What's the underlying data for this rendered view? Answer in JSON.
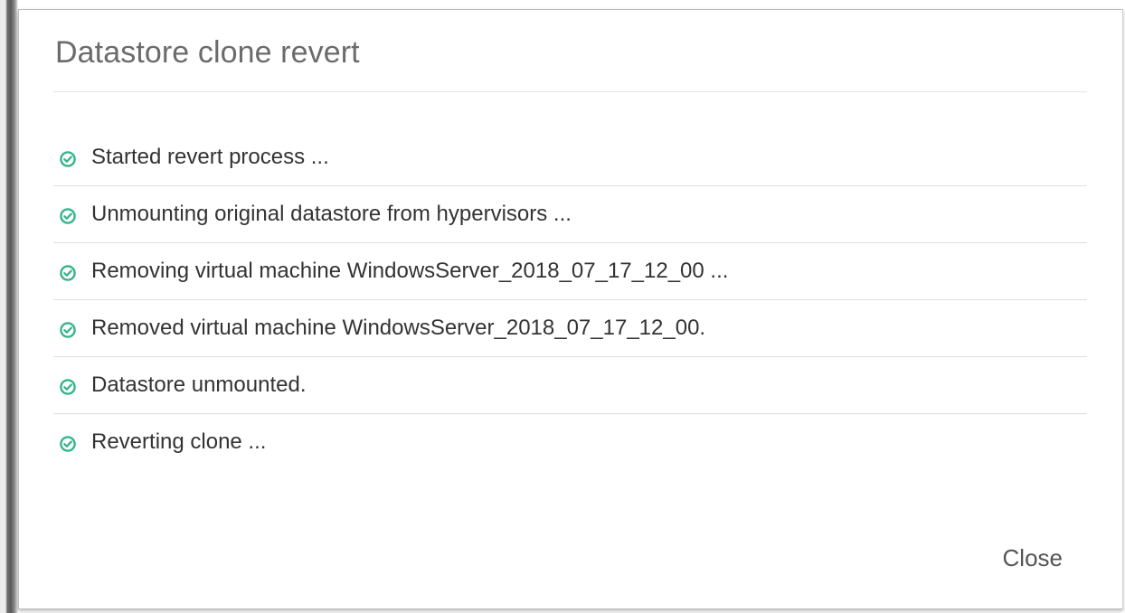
{
  "dialog": {
    "title": "Datastore clone revert",
    "close_label": "Close"
  },
  "log": {
    "items": [
      {
        "text": "Started revert process ...",
        "status": "success"
      },
      {
        "text": "Unmounting original datastore from hypervisors ...",
        "status": "success"
      },
      {
        "text": "Removing virtual machine WindowsServer_2018_07_17_12_00 ...",
        "status": "success"
      },
      {
        "text": "Removed virtual machine WindowsServer_2018_07_17_12_00.",
        "status": "success"
      },
      {
        "text": "Datastore unmounted.",
        "status": "success"
      },
      {
        "text": "Reverting clone ...",
        "status": "success"
      }
    ]
  },
  "icons": {
    "status": "check-circle-icon"
  },
  "colors": {
    "success": "#36b58a",
    "title": "#6b6b6b",
    "text": "#333333"
  }
}
